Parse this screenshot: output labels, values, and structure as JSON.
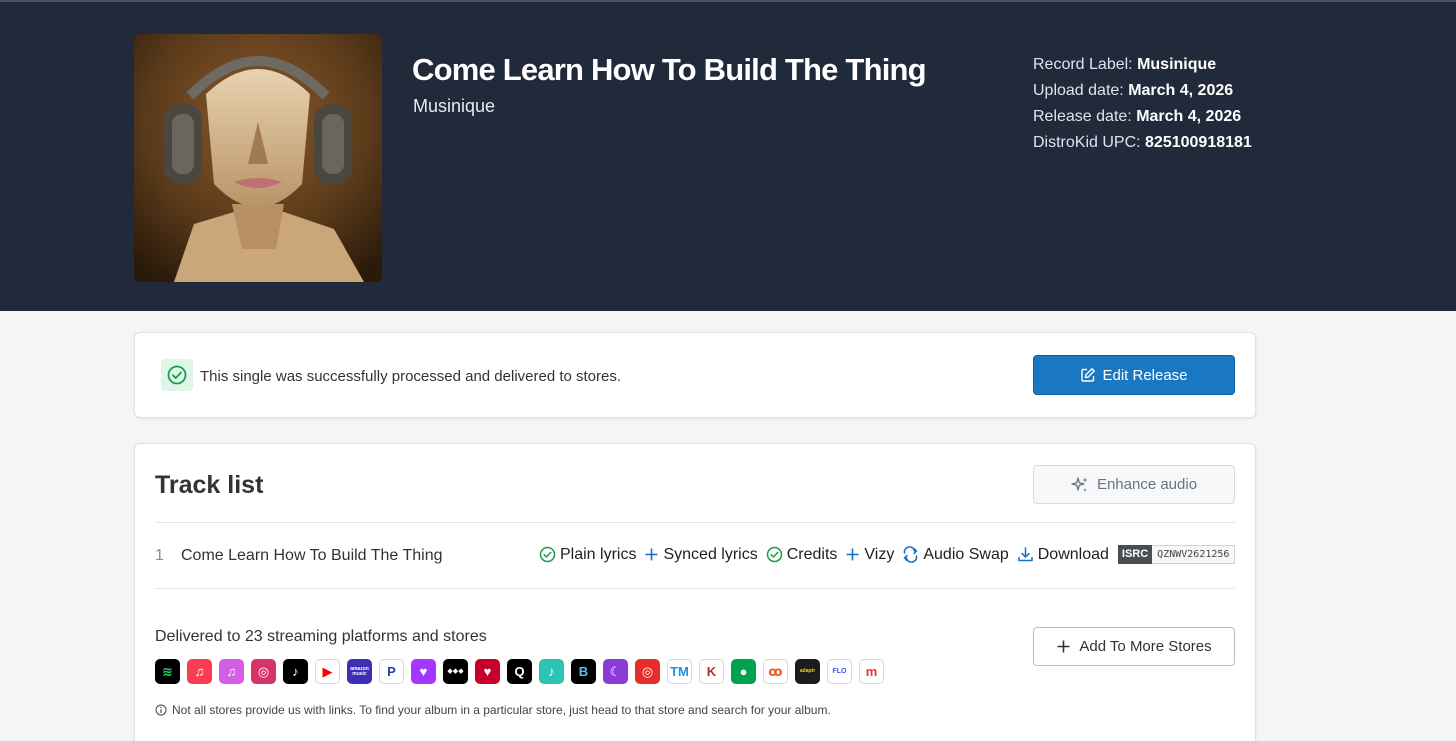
{
  "release": {
    "title": "Come Learn How To Build The Thing",
    "artist": "Musinique"
  },
  "meta": {
    "label_key": "Record Label:",
    "label_value": "Musinique",
    "upload_key": "Upload date:",
    "upload_value": "March 4, 2026",
    "release_key": "Release date:",
    "release_value": "March 4, 2026",
    "upc_key": "DistroKid UPC:",
    "upc_value": "825100918181"
  },
  "status": {
    "message": "This single was successfully processed and delivered to stores.",
    "edit_label": "Edit Release"
  },
  "tracklist": {
    "heading": "Track list",
    "enhance_label": "Enhance audio",
    "tracks": [
      {
        "number": "1",
        "title": "Come Learn How To Build The Thing",
        "plain_lyrics": "Plain lyrics",
        "synced_lyrics": "Synced lyrics",
        "credits": "Credits",
        "vizy": "Vizy",
        "audio_swap": "Audio Swap",
        "download": "Download",
        "isrc_label": "ISRC",
        "isrc_code": "QZNWV2621256"
      }
    ]
  },
  "stores": {
    "delivered_text": "Delivered to 23 streaming platforms and stores",
    "add_label": "Add To More Stores",
    "note": "Not all stores provide us with links. To find your album in a particular store, just head to that store and search for your album.",
    "icons": [
      {
        "name": "spotify-icon",
        "bg": "#000000",
        "fg": "#1ed760",
        "glyph": "≋"
      },
      {
        "name": "apple-music-icon",
        "bg": "#fa3d52",
        "fg": "#ffffff",
        "glyph": "♫"
      },
      {
        "name": "itunes-icon",
        "bg": "#d45ee6",
        "fg": "#ffffff",
        "glyph": "♫"
      },
      {
        "name": "instagram-icon",
        "bg": "#d6336c",
        "fg": "#ffffff",
        "glyph": "◎"
      },
      {
        "name": "tiktok-icon",
        "bg": "#000000",
        "fg": "#ffffff",
        "glyph": "♪"
      },
      {
        "name": "youtube-music-icon",
        "bg": "#ffffff",
        "fg": "#ff0000",
        "glyph": "▶"
      },
      {
        "name": "amazon-music-icon",
        "bg": "#3b2fb5",
        "fg": "#ffffff",
        "glyph": "amazon music"
      },
      {
        "name": "pandora-icon",
        "bg": "#ffffff",
        "fg": "#224099",
        "glyph": "P"
      },
      {
        "name": "deezer-icon",
        "bg": "#a238ff",
        "fg": "#ffffff",
        "glyph": "♥"
      },
      {
        "name": "tidal-icon",
        "bg": "#000000",
        "fg": "#ffffff",
        "glyph": "◆◆◆"
      },
      {
        "name": "iheartradio-icon",
        "bg": "#c6002b",
        "fg": "#ffffff",
        "glyph": "♥"
      },
      {
        "name": "qobuz-icon",
        "bg": "#000000",
        "fg": "#ffffff",
        "glyph": "Q"
      },
      {
        "name": "jiosaavn-icon",
        "bg": "#2bc5b4",
        "fg": "#ffffff",
        "glyph": "♪"
      },
      {
        "name": "boomplay-icon",
        "bg": "#000000",
        "fg": "#4ec6f0",
        "glyph": "B"
      },
      {
        "name": "anghami-icon",
        "bg": "#8b3bd8",
        "fg": "#ffffff",
        "glyph": "☾"
      },
      {
        "name": "netease-icon",
        "bg": "#e72d2c",
        "fg": "#ffffff",
        "glyph": "◎"
      },
      {
        "name": "tencent-icon",
        "bg": "#ffffff",
        "fg": "#1f8fe0",
        "glyph": "TM"
      },
      {
        "name": "kkbox-icon",
        "bg": "#ffffff",
        "fg": "#c0272d",
        "glyph": "K"
      },
      {
        "name": "joox-icon",
        "bg": "#00a34d",
        "fg": "#ffffff",
        "glyph": "●"
      },
      {
        "name": "audiomack-icon",
        "bg": "#ffffff",
        "fg": "#f15a24",
        "glyph": "ꝏ"
      },
      {
        "name": "adaptr-icon",
        "bg": "#1c1c1c",
        "fg": "#ffcc00",
        "glyph": "adaptr"
      },
      {
        "name": "flo-icon",
        "bg": "#ffffff",
        "fg": "#3d56f0",
        "glyph": "FLO"
      },
      {
        "name": "melon-icon",
        "bg": "#ffffff",
        "fg": "#e4353a",
        "glyph": "m"
      }
    ]
  },
  "colors": {
    "hero_bg": "#212a3b",
    "primary": "#1a78c2",
    "success": "#1a9e4b",
    "link_blue": "#1a6fc4"
  }
}
